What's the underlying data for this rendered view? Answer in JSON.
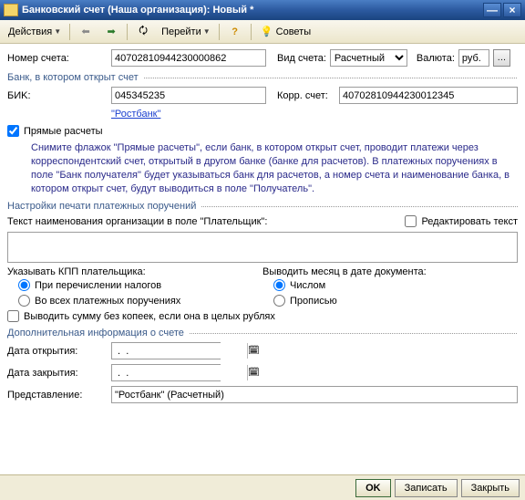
{
  "title": "Банковский счет (Наша организация): Новый *",
  "toolbar": {
    "actions": "Действия",
    "goto": "Перейти",
    "tips": "Советы"
  },
  "labels": {
    "account_no": "Номер счета:",
    "account_type": "Вид счета:",
    "currency": "Валюта:",
    "bank_section": "Банк, в котором открыт счет",
    "bik": "БИK:",
    "korr": "Корр. счет:",
    "direct": "Прямые расчеты",
    "print_section": "Настройки печати платежных поручений",
    "payer_text": "Текст наименования организации в поле \"Плательщик\":",
    "edit_text": "Редактировать текст",
    "kpp_label": "Указывать КПП плательщика:",
    "kpp_opt1": "При перечислении налогов",
    "kpp_opt2": "Во всех платежных поручениях",
    "month_label": "Выводить месяц в дате документа:",
    "month_opt1": "Числом",
    "month_opt2": "Прописью",
    "no_kopecks": "Выводить сумму без копеек, если она в целых рублях",
    "additional_section": "Дополнительная информация о счете",
    "open_date": "Дата открытия:",
    "close_date": "Дата закрытия:",
    "representation": "Представление:"
  },
  "values": {
    "account_no": "40702810944230000862",
    "account_type": "Расчетный",
    "currency": "руб.",
    "bik": "045345235",
    "korr": "40702810944230012345",
    "bank_link": "\"Ростбанк\"",
    "open_date": " .  .    ",
    "close_date": " .  .    ",
    "representation": "\"Ростбанк\" (Расчетный)"
  },
  "hint": "Снимите флажок \"Прямые расчеты\", если банк, в котором открыт счет, проводит платежи через корреспондентский счет, открытый в другом банке (банке для расчетов). В платежных поручениях в поле \"Банк получателя\" будет указываться банк для расчетов, а номер счета и наименование банка, в котором открыт счет, будут выводиться в поле \"Получатель\".",
  "buttons": {
    "ok": "OK",
    "save": "Записать",
    "close": "Закрыть"
  }
}
